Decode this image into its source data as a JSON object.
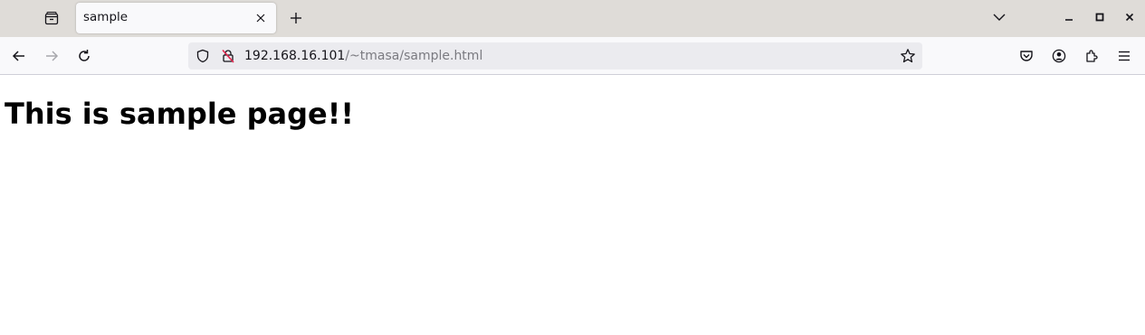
{
  "tab": {
    "title": "sample"
  },
  "urlbar": {
    "host": "192.168.16.101",
    "path": "/~tmasa/sample.html"
  },
  "page": {
    "heading": "This is sample page!!"
  },
  "colors": {
    "tabstrip_bg": "#dfdcd8",
    "toolbar_bg": "#f9f9fb",
    "urlbar_bg": "#ebebef",
    "insecure_icon": "#e22850"
  },
  "icons": {
    "tab_list": "firefox-view-icon",
    "tab_close": "close-icon",
    "new_tab": "plus-icon",
    "tabs_dropdown": "chevron-down-icon",
    "back": "back-arrow-icon",
    "forward": "forward-arrow-icon",
    "reload": "reload-icon",
    "tracking_protection": "shield-icon",
    "insecure": "insecure-lock-icon",
    "bookmark": "star-icon",
    "pocket": "pocket-icon",
    "account": "account-icon",
    "extensions": "extensions-icon",
    "menu": "hamburger-menu-icon"
  }
}
